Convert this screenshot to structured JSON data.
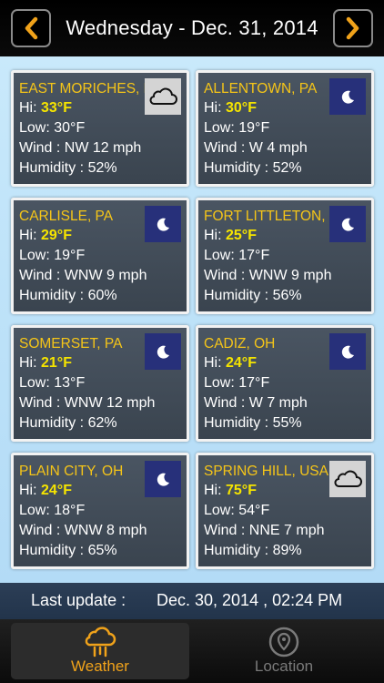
{
  "header": {
    "title": "Wednesday - Dec. 31, 2014",
    "prev_icon": "chevron-left-icon",
    "next_icon": "chevron-right-icon",
    "accent": "#f0a21a"
  },
  "cards": [
    {
      "city": "EAST MORICHES, NY",
      "hi_label": "Hi: ",
      "hi": "33°F",
      "low": "Low: 30°F",
      "wind": "Wind : NW 12 mph",
      "humidity": "Humidity : 52%",
      "icon": "cloud-icon"
    },
    {
      "city": "ALLENTOWN, PA",
      "hi_label": "Hi: ",
      "hi": "30°F",
      "low": "Low: 19°F",
      "wind": "Wind : W 4 mph",
      "humidity": "Humidity : 52%",
      "icon": "moon-icon"
    },
    {
      "city": "CARLISLE, PA",
      "hi_label": "Hi: ",
      "hi": "29°F",
      "low": "Low: 19°F",
      "wind": "Wind : WNW 9 mph",
      "humidity": "Humidity : 60%",
      "icon": "moon-icon"
    },
    {
      "city": "FORT LITTLETON, PA",
      "hi_label": "Hi: ",
      "hi": "25°F",
      "low": "Low: 17°F",
      "wind": "Wind : WNW 9 mph",
      "humidity": "Humidity : 56%",
      "icon": "moon-icon"
    },
    {
      "city": "SOMERSET, PA",
      "hi_label": "Hi: ",
      "hi": "21°F",
      "low": "Low: 13°F",
      "wind": "Wind : WNW 12 mph",
      "humidity": "Humidity : 62%",
      "icon": "moon-icon"
    },
    {
      "city": "CADIZ, OH",
      "hi_label": "Hi: ",
      "hi": "24°F",
      "low": "Low: 17°F",
      "wind": "Wind : W 7 mph",
      "humidity": "Humidity : 55%",
      "icon": "moon-icon"
    },
    {
      "city": "PLAIN CITY, OH",
      "hi_label": "Hi: ",
      "hi": "24°F",
      "low": "Low: 18°F",
      "wind": "Wind : WNW 8 mph",
      "humidity": "Humidity : 65%",
      "icon": "moon-icon"
    },
    {
      "city": "SPRING HILL, USA",
      "hi_label": "Hi: ",
      "hi": "75°F",
      "low": "Low: 54°F",
      "wind": "Wind : NNE 7 mph",
      "humidity": "Humidity : 89%",
      "icon": "cloud-icon"
    }
  ],
  "status": {
    "label": "Last update :",
    "value": "Dec. 30, 2014 , 02:24 PM"
  },
  "tabs": [
    {
      "label": "Weather",
      "icon": "rain-cloud-icon",
      "active": true
    },
    {
      "label": "Location",
      "icon": "location-pin-icon",
      "active": false
    }
  ]
}
